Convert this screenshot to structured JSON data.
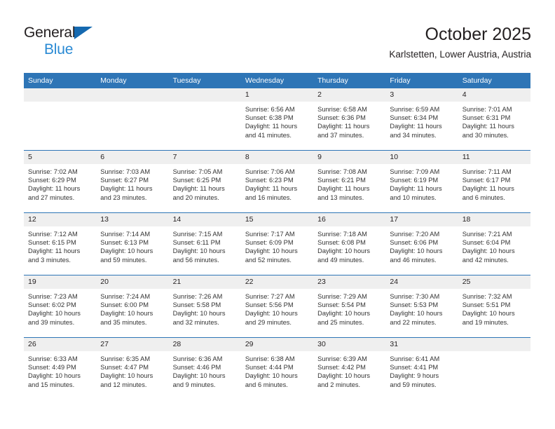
{
  "brand": {
    "line1": "General",
    "line2": "Blue",
    "color_dark": "#231f20",
    "color_blue": "#2a8ad4"
  },
  "header": {
    "title": "October 2025",
    "subtitle": "Karlstetten, Lower Austria, Austria"
  },
  "theme": {
    "header_blue": "#2e75b6",
    "daynum_gray": "#efefef",
    "text": "#231f20"
  },
  "weekday_headers": [
    "Sunday",
    "Monday",
    "Tuesday",
    "Wednesday",
    "Thursday",
    "Friday",
    "Saturday"
  ],
  "weeks": [
    [
      {
        "day": "",
        "sunrise": "",
        "sunset": "",
        "daylight_line1": "",
        "daylight_line2": ""
      },
      {
        "day": "",
        "sunrise": "",
        "sunset": "",
        "daylight_line1": "",
        "daylight_line2": ""
      },
      {
        "day": "",
        "sunrise": "",
        "sunset": "",
        "daylight_line1": "",
        "daylight_line2": ""
      },
      {
        "day": "1",
        "sunrise": "Sunrise: 6:56 AM",
        "sunset": "Sunset: 6:38 PM",
        "daylight_line1": "Daylight: 11 hours",
        "daylight_line2": "and 41 minutes."
      },
      {
        "day": "2",
        "sunrise": "Sunrise: 6:58 AM",
        "sunset": "Sunset: 6:36 PM",
        "daylight_line1": "Daylight: 11 hours",
        "daylight_line2": "and 37 minutes."
      },
      {
        "day": "3",
        "sunrise": "Sunrise: 6:59 AM",
        "sunset": "Sunset: 6:34 PM",
        "daylight_line1": "Daylight: 11 hours",
        "daylight_line2": "and 34 minutes."
      },
      {
        "day": "4",
        "sunrise": "Sunrise: 7:01 AM",
        "sunset": "Sunset: 6:31 PM",
        "daylight_line1": "Daylight: 11 hours",
        "daylight_line2": "and 30 minutes."
      }
    ],
    [
      {
        "day": "5",
        "sunrise": "Sunrise: 7:02 AM",
        "sunset": "Sunset: 6:29 PM",
        "daylight_line1": "Daylight: 11 hours",
        "daylight_line2": "and 27 minutes."
      },
      {
        "day": "6",
        "sunrise": "Sunrise: 7:03 AM",
        "sunset": "Sunset: 6:27 PM",
        "daylight_line1": "Daylight: 11 hours",
        "daylight_line2": "and 23 minutes."
      },
      {
        "day": "7",
        "sunrise": "Sunrise: 7:05 AM",
        "sunset": "Sunset: 6:25 PM",
        "daylight_line1": "Daylight: 11 hours",
        "daylight_line2": "and 20 minutes."
      },
      {
        "day": "8",
        "sunrise": "Sunrise: 7:06 AM",
        "sunset": "Sunset: 6:23 PM",
        "daylight_line1": "Daylight: 11 hours",
        "daylight_line2": "and 16 minutes."
      },
      {
        "day": "9",
        "sunrise": "Sunrise: 7:08 AM",
        "sunset": "Sunset: 6:21 PM",
        "daylight_line1": "Daylight: 11 hours",
        "daylight_line2": "and 13 minutes."
      },
      {
        "day": "10",
        "sunrise": "Sunrise: 7:09 AM",
        "sunset": "Sunset: 6:19 PM",
        "daylight_line1": "Daylight: 11 hours",
        "daylight_line2": "and 10 minutes."
      },
      {
        "day": "11",
        "sunrise": "Sunrise: 7:11 AM",
        "sunset": "Sunset: 6:17 PM",
        "daylight_line1": "Daylight: 11 hours",
        "daylight_line2": "and 6 minutes."
      }
    ],
    [
      {
        "day": "12",
        "sunrise": "Sunrise: 7:12 AM",
        "sunset": "Sunset: 6:15 PM",
        "daylight_line1": "Daylight: 11 hours",
        "daylight_line2": "and 3 minutes."
      },
      {
        "day": "13",
        "sunrise": "Sunrise: 7:14 AM",
        "sunset": "Sunset: 6:13 PM",
        "daylight_line1": "Daylight: 10 hours",
        "daylight_line2": "and 59 minutes."
      },
      {
        "day": "14",
        "sunrise": "Sunrise: 7:15 AM",
        "sunset": "Sunset: 6:11 PM",
        "daylight_line1": "Daylight: 10 hours",
        "daylight_line2": "and 56 minutes."
      },
      {
        "day": "15",
        "sunrise": "Sunrise: 7:17 AM",
        "sunset": "Sunset: 6:09 PM",
        "daylight_line1": "Daylight: 10 hours",
        "daylight_line2": "and 52 minutes."
      },
      {
        "day": "16",
        "sunrise": "Sunrise: 7:18 AM",
        "sunset": "Sunset: 6:08 PM",
        "daylight_line1": "Daylight: 10 hours",
        "daylight_line2": "and 49 minutes."
      },
      {
        "day": "17",
        "sunrise": "Sunrise: 7:20 AM",
        "sunset": "Sunset: 6:06 PM",
        "daylight_line1": "Daylight: 10 hours",
        "daylight_line2": "and 46 minutes."
      },
      {
        "day": "18",
        "sunrise": "Sunrise: 7:21 AM",
        "sunset": "Sunset: 6:04 PM",
        "daylight_line1": "Daylight: 10 hours",
        "daylight_line2": "and 42 minutes."
      }
    ],
    [
      {
        "day": "19",
        "sunrise": "Sunrise: 7:23 AM",
        "sunset": "Sunset: 6:02 PM",
        "daylight_line1": "Daylight: 10 hours",
        "daylight_line2": "and 39 minutes."
      },
      {
        "day": "20",
        "sunrise": "Sunrise: 7:24 AM",
        "sunset": "Sunset: 6:00 PM",
        "daylight_line1": "Daylight: 10 hours",
        "daylight_line2": "and 35 minutes."
      },
      {
        "day": "21",
        "sunrise": "Sunrise: 7:26 AM",
        "sunset": "Sunset: 5:58 PM",
        "daylight_line1": "Daylight: 10 hours",
        "daylight_line2": "and 32 minutes."
      },
      {
        "day": "22",
        "sunrise": "Sunrise: 7:27 AM",
        "sunset": "Sunset: 5:56 PM",
        "daylight_line1": "Daylight: 10 hours",
        "daylight_line2": "and 29 minutes."
      },
      {
        "day": "23",
        "sunrise": "Sunrise: 7:29 AM",
        "sunset": "Sunset: 5:54 PM",
        "daylight_line1": "Daylight: 10 hours",
        "daylight_line2": "and 25 minutes."
      },
      {
        "day": "24",
        "sunrise": "Sunrise: 7:30 AM",
        "sunset": "Sunset: 5:53 PM",
        "daylight_line1": "Daylight: 10 hours",
        "daylight_line2": "and 22 minutes."
      },
      {
        "day": "25",
        "sunrise": "Sunrise: 7:32 AM",
        "sunset": "Sunset: 5:51 PM",
        "daylight_line1": "Daylight: 10 hours",
        "daylight_line2": "and 19 minutes."
      }
    ],
    [
      {
        "day": "26",
        "sunrise": "Sunrise: 6:33 AM",
        "sunset": "Sunset: 4:49 PM",
        "daylight_line1": "Daylight: 10 hours",
        "daylight_line2": "and 15 minutes."
      },
      {
        "day": "27",
        "sunrise": "Sunrise: 6:35 AM",
        "sunset": "Sunset: 4:47 PM",
        "daylight_line1": "Daylight: 10 hours",
        "daylight_line2": "and 12 minutes."
      },
      {
        "day": "28",
        "sunrise": "Sunrise: 6:36 AM",
        "sunset": "Sunset: 4:46 PM",
        "daylight_line1": "Daylight: 10 hours",
        "daylight_line2": "and 9 minutes."
      },
      {
        "day": "29",
        "sunrise": "Sunrise: 6:38 AM",
        "sunset": "Sunset: 4:44 PM",
        "daylight_line1": "Daylight: 10 hours",
        "daylight_line2": "and 6 minutes."
      },
      {
        "day": "30",
        "sunrise": "Sunrise: 6:39 AM",
        "sunset": "Sunset: 4:42 PM",
        "daylight_line1": "Daylight: 10 hours",
        "daylight_line2": "and 2 minutes."
      },
      {
        "day": "31",
        "sunrise": "Sunrise: 6:41 AM",
        "sunset": "Sunset: 4:41 PM",
        "daylight_line1": "Daylight: 9 hours",
        "daylight_line2": "and 59 minutes."
      },
      {
        "day": "",
        "sunrise": "",
        "sunset": "",
        "daylight_line1": "",
        "daylight_line2": ""
      }
    ]
  ]
}
